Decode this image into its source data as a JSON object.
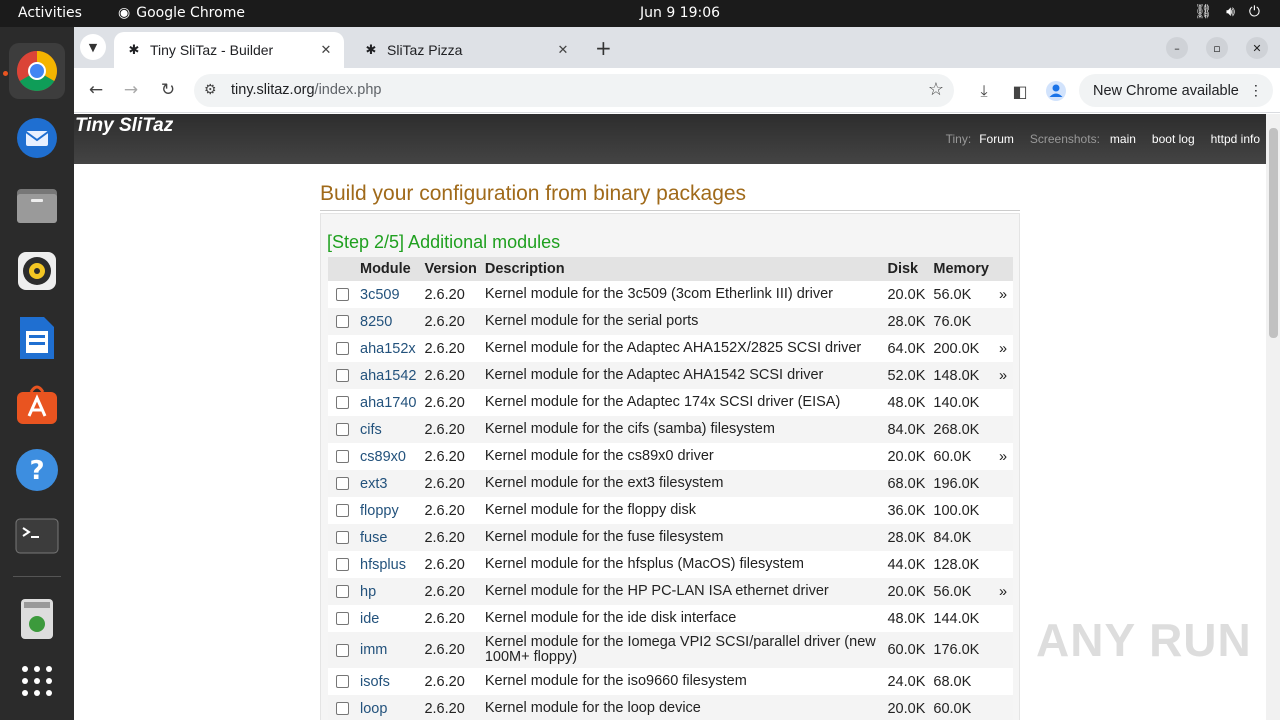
{
  "topbar": {
    "activities": "Activities",
    "app_name": "Google Chrome",
    "clock": "Jun 9  19:06"
  },
  "dock": {
    "items": [
      "Google Chrome",
      "Thunderbird",
      "Files",
      "Rhythmbox",
      "LibreOffice Writer",
      "Ubuntu Software",
      "Help",
      "Terminal",
      "Trash",
      "Show Applications"
    ]
  },
  "browser": {
    "tabs": [
      {
        "title": "Tiny SliTaz - Builder",
        "active": true
      },
      {
        "title": "SliTaz Pizza",
        "active": false
      }
    ],
    "url_host": "tiny.slitaz.org",
    "url_path": "/index.php",
    "update_label": "New Chrome available"
  },
  "site": {
    "title": "Tiny SliTaz",
    "nav": {
      "tiny_label": "Tiny:",
      "forum": "Forum",
      "screenshots_label": "Screenshots:",
      "main": "main",
      "boot_log": "boot log",
      "httpd_info": "httpd info"
    }
  },
  "content": {
    "title": "Build your configuration from binary packages",
    "step_title": "[Step 2/5] Additional modules",
    "columns": [
      "Module",
      "Version",
      "Description",
      "Disk",
      "Memory"
    ],
    "rows": [
      {
        "module": "3c509",
        "version": "2.6.20",
        "description": "Kernel module for the 3c509 (3com Etherlink III) driver",
        "disk": "20.0K",
        "memory": "56.0K",
        "more": "»"
      },
      {
        "module": "8250",
        "version": "2.6.20",
        "description": "Kernel module for the serial ports",
        "disk": "28.0K",
        "memory": "76.0K",
        "more": ""
      },
      {
        "module": "aha152x",
        "version": "2.6.20",
        "description": "Kernel module for the Adaptec AHA152X/2825 SCSI driver",
        "disk": "64.0K",
        "memory": "200.0K",
        "more": "»"
      },
      {
        "module": "aha1542",
        "version": "2.6.20",
        "description": "Kernel module for the Adaptec AHA1542 SCSI driver",
        "disk": "52.0K",
        "memory": "148.0K",
        "more": "»"
      },
      {
        "module": "aha1740",
        "version": "2.6.20",
        "description": "Kernel module for the Adaptec 174x SCSI driver (EISA)",
        "disk": "48.0K",
        "memory": "140.0K",
        "more": ""
      },
      {
        "module": "cifs",
        "version": "2.6.20",
        "description": "Kernel module for the cifs (samba) filesystem",
        "disk": "84.0K",
        "memory": "268.0K",
        "more": ""
      },
      {
        "module": "cs89x0",
        "version": "2.6.20",
        "description": "Kernel module for the cs89x0 driver",
        "disk": "20.0K",
        "memory": "60.0K",
        "more": "»"
      },
      {
        "module": "ext3",
        "version": "2.6.20",
        "description": "Kernel module for the ext3 filesystem",
        "disk": "68.0K",
        "memory": "196.0K",
        "more": ""
      },
      {
        "module": "floppy",
        "version": "2.6.20",
        "description": "Kernel module for the floppy disk",
        "disk": "36.0K",
        "memory": "100.0K",
        "more": ""
      },
      {
        "module": "fuse",
        "version": "2.6.20",
        "description": "Kernel module for the fuse filesystem",
        "disk": "28.0K",
        "memory": "84.0K",
        "more": ""
      },
      {
        "module": "hfsplus",
        "version": "2.6.20",
        "description": "Kernel module for the hfsplus (MacOS) filesystem",
        "disk": "44.0K",
        "memory": "128.0K",
        "more": ""
      },
      {
        "module": "hp",
        "version": "2.6.20",
        "description": "Kernel module for the HP PC-LAN ISA ethernet driver",
        "disk": "20.0K",
        "memory": "56.0K",
        "more": "»"
      },
      {
        "module": "ide",
        "version": "2.6.20",
        "description": "Kernel module for the ide disk interface",
        "disk": "48.0K",
        "memory": "144.0K",
        "more": ""
      },
      {
        "module": "imm",
        "version": "2.6.20",
        "description": "Kernel module for the Iomega VPI2 SCSI/parallel driver (new 100M+ floppy)",
        "disk": "60.0K",
        "memory": "176.0K",
        "more": ""
      },
      {
        "module": "isofs",
        "version": "2.6.20",
        "description": "Kernel module for the iso9660 filesystem",
        "disk": "24.0K",
        "memory": "68.0K",
        "more": ""
      },
      {
        "module": "loop",
        "version": "2.6.20",
        "description": "Kernel module for the loop device",
        "disk": "20.0K",
        "memory": "60.0K",
        "more": ""
      }
    ]
  },
  "watermark": "ANY RUN",
  "colors": {
    "step_title": "#1fa01f",
    "page_title": "#a06a1a",
    "link": "#23527c",
    "header_bg": "#3a3a3a"
  }
}
